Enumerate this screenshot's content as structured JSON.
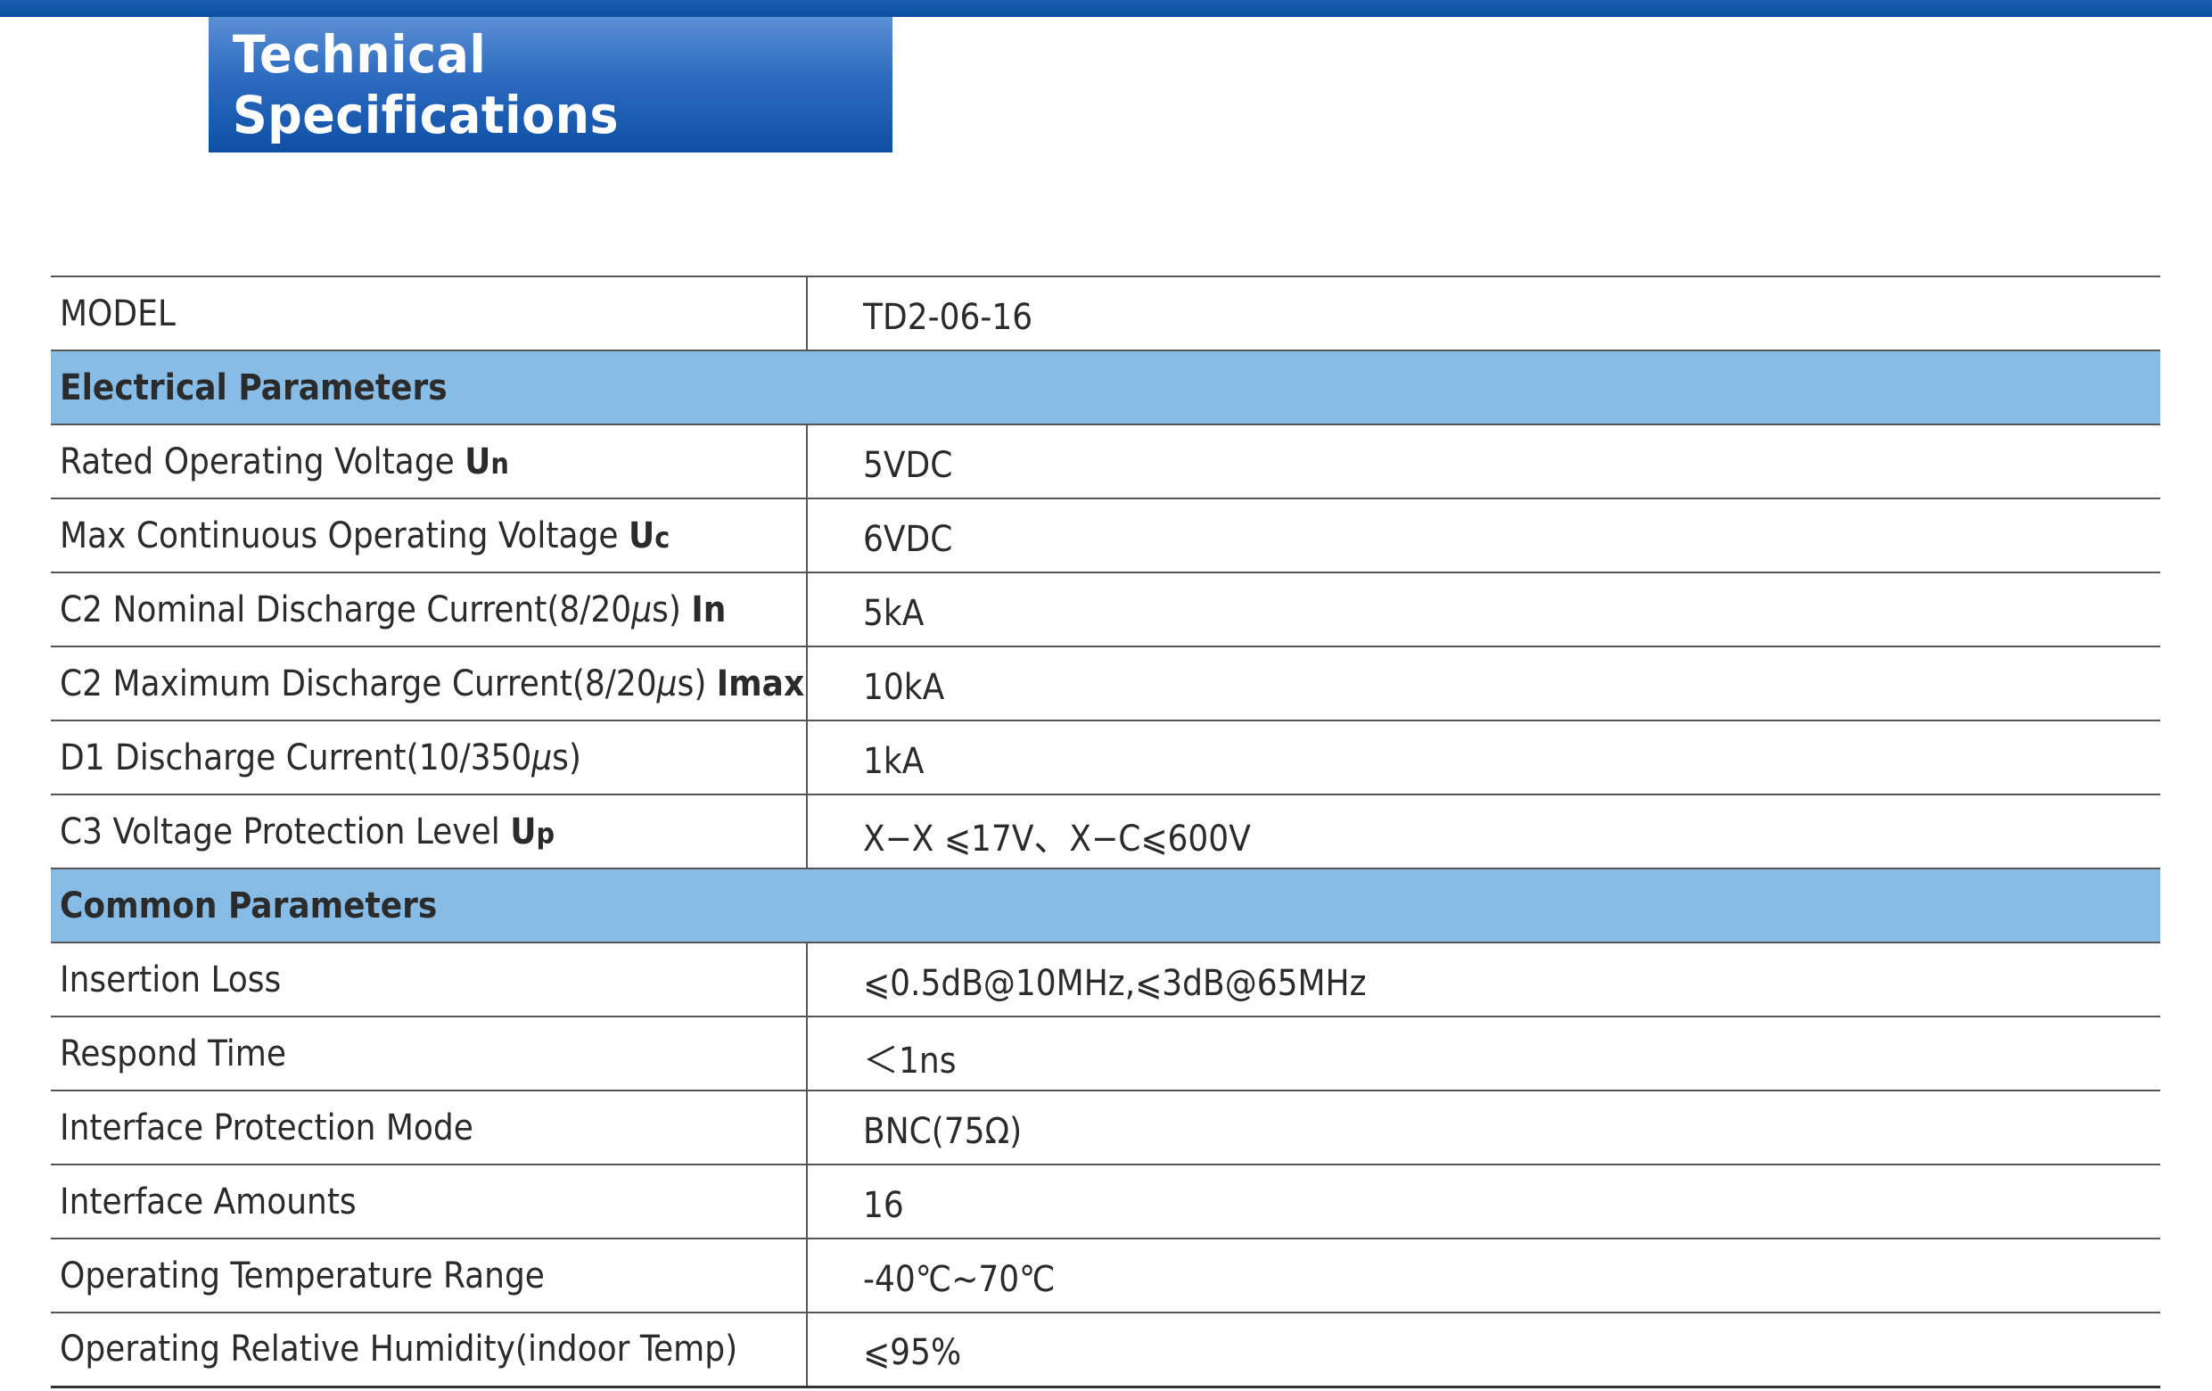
{
  "header": {
    "title": "Technical Specifications"
  },
  "table": {
    "model": {
      "label": "MODEL",
      "value": "TD2-06-16"
    },
    "sections": [
      {
        "title": "Electrical Parameters",
        "rows": [
          {
            "label": "Rated Operating Voltage",
            "symbol": "U",
            "sub": "n",
            "value": "5VDC"
          },
          {
            "label": "Max Continuous Operating Voltage",
            "symbol": "U",
            "sub": "c",
            "value": "6VDC"
          },
          {
            "label_pre": "C2 Nominal Discharge Current(8/20",
            "mu": "μ",
            "label_post": "s)",
            "symbol": "In",
            "value": "5kA"
          },
          {
            "label_pre": "C2 Maximum Discharge Current(8/20",
            "mu": "μ",
            "label_post": "s)",
            "symbol": "Imax",
            "value": "10kA"
          },
          {
            "label_pre": "D1 Discharge Current(10/350",
            "mu": "μ",
            "label_post": "s)",
            "value": "1kA"
          },
          {
            "label": "C3 Voltage Protection Level",
            "symbol": "U",
            "sub": "p",
            "value": "X−X ⩽17V、X−C⩽600V"
          }
        ]
      },
      {
        "title": "Common Parameters",
        "rows": [
          {
            "label": "Insertion Loss",
            "value": "⩽0.5dB@10MHz,⩽3dB@65MHz"
          },
          {
            "label": "Respond Time",
            "value": "＜1ns"
          },
          {
            "label": "Interface Protection Mode",
            "value": "BNC(75Ω)"
          },
          {
            "label": "Interface Amounts",
            "value": "16"
          },
          {
            "label": "Operating Temperature Range",
            "value": "-40℃~70℃"
          },
          {
            "label": "Operating Relative Humidity(indoor Temp)",
            "value": "⩽95%"
          }
        ]
      }
    ]
  }
}
